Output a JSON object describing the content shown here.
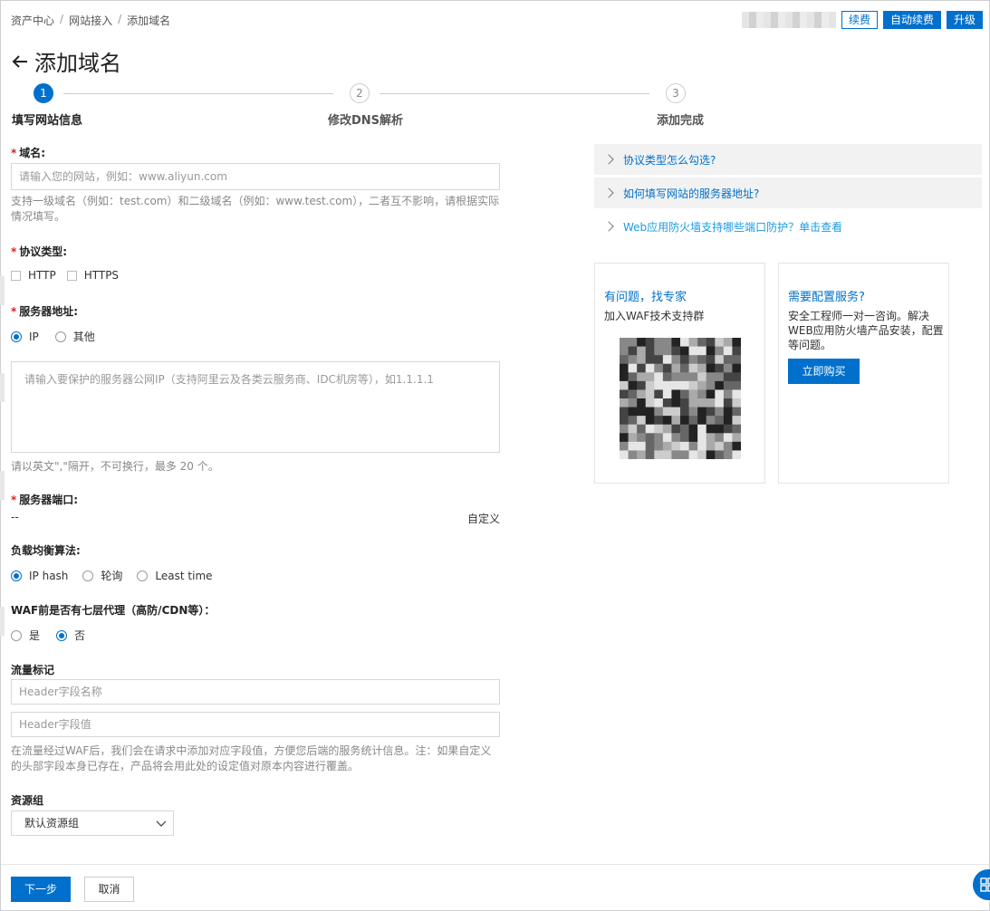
{
  "breadcrumb": [
    "资产中心",
    "网站接入",
    "添加域名"
  ],
  "top_actions": {
    "renew_label": "续费",
    "auto_renew_label": "自动续费",
    "upgrade_label": "升级"
  },
  "page_title": "添加域名",
  "steps": [
    {
      "number": "1",
      "label": "填写网站信息",
      "active": true
    },
    {
      "number": "2",
      "label": "修改DNS解析",
      "active": false
    },
    {
      "number": "3",
      "label": "添加完成",
      "active": false
    }
  ],
  "form": {
    "domain": {
      "label": "域名:",
      "placeholder": "请输入您的网站，例如：www.aliyun.com",
      "help": "支持一级域名（例如：test.com）和二级域名（例如：www.test.com），二者互不影响，请根据实际情况填写。"
    },
    "protocol": {
      "label": "协议类型:",
      "options": [
        "HTTP",
        "HTTPS"
      ]
    },
    "server_address": {
      "label": "服务器地址:",
      "options": [
        "IP",
        "其他"
      ],
      "selected": "IP",
      "placeholder": "请输入要保护的服务器公网IP（支持阿里云及各类云服务商、IDC机房等），如1.1.1.1",
      "help": "请以英文\",\"隔开，不可换行，最多 20 个。"
    },
    "server_port": {
      "label": "服务器端口:",
      "value": "--",
      "custom_label": "自定义"
    },
    "load_balance": {
      "label": "负载均衡算法:",
      "options": [
        "IP hash",
        "轮询",
        "Least time"
      ],
      "selected": "IP hash"
    },
    "proxy": {
      "label": "WAF前是否有七层代理（高防/CDN等）：",
      "options": [
        "是",
        "否"
      ],
      "selected": "否"
    },
    "traffic_mark": {
      "label": "流量标记",
      "name_placeholder": "Header字段名称",
      "value_placeholder": "Header字段值",
      "help": "在流量经过WAF后，我们会在请求中添加对应字段值，方便您后端的服务统计信息。注：如果自定义的头部字段本身已存在，产品将会用此处的设定值对原本内容进行覆盖。"
    },
    "resource_group": {
      "label": "资源组",
      "value": "默认资源组"
    }
  },
  "faq": [
    "协议类型怎么勾选?",
    "如何填写网站的服务器地址?",
    "Web应用防火墙支持哪些端口防护？单击查看"
  ],
  "expert_card": {
    "title": "有问题，找专家",
    "text": "加入WAF技术支持群"
  },
  "service_card": {
    "title": "需要配置服务?",
    "text": "安全工程师一对一咨询。解决WEB应用防火墙产品安装，配置等问题。",
    "button_label": "立即购买"
  },
  "footer": {
    "next_label": "下一步",
    "cancel_label": "取消"
  },
  "colors": {
    "accent": "#0070cc",
    "required": "#e02020"
  }
}
